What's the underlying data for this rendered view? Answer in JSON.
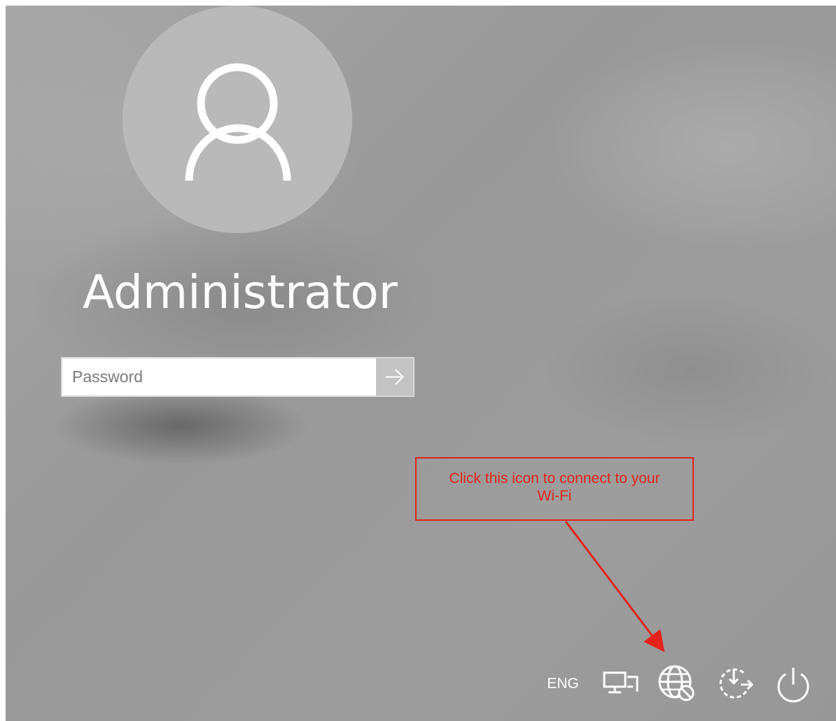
{
  "login": {
    "user_name": "Administrator",
    "avatar_icon": "user-silhouette-icon",
    "password_placeholder": "Password",
    "password_value": "",
    "submit_icon": "arrow-right-icon"
  },
  "callout": {
    "text_line1": "Click this icon to connect to your",
    "text_line2": "Wi-Fi",
    "color": "#e3231c"
  },
  "tray": {
    "language": "ENG",
    "icons": [
      "display-icon",
      "network-icon",
      "ease-of-access-icon",
      "power-icon"
    ]
  },
  "colors": {
    "background": "#9d9d9d",
    "avatar": "#b9b9b9",
    "submit_button": "#c3c3c3",
    "text": "#ffffff"
  }
}
